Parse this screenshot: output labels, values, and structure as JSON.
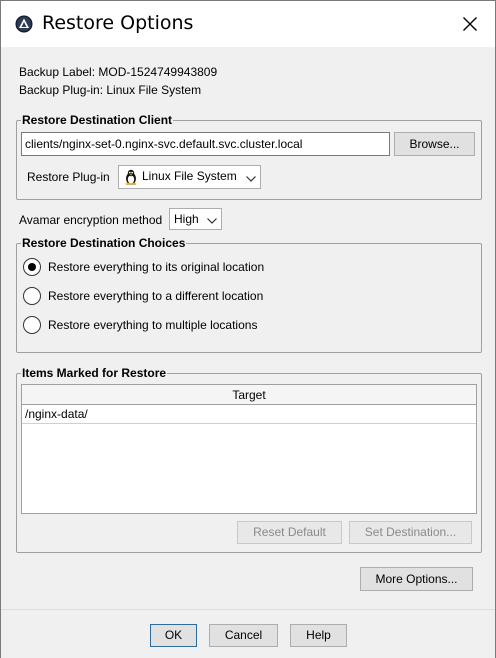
{
  "window": {
    "title": "Restore Options"
  },
  "info": {
    "backup_label": "Backup Label: MOD-1524749943809",
    "backup_plugin": "Backup Plug-in: Linux File System"
  },
  "destination_client": {
    "legend": "Restore Destination Client",
    "client_value": "clients/nginx-set-0.nginx-svc.default.svc.cluster.local",
    "browse_label": "Browse...",
    "plugin_label": "Restore Plug-in",
    "plugin_value": "Linux File System"
  },
  "encryption": {
    "label": "Avamar encryption method",
    "value": "High"
  },
  "destination_choices": {
    "legend": "Restore Destination Choices",
    "options": [
      {
        "label": "Restore everything to its original location",
        "selected": true
      },
      {
        "label": "Restore everything to a different location",
        "selected": false
      },
      {
        "label": "Restore everything to multiple locations",
        "selected": false
      }
    ]
  },
  "items": {
    "legend": "Items Marked for Restore",
    "columns": [
      "Target"
    ],
    "rows": [
      {
        "target": "/nginx-data/"
      }
    ],
    "reset_default_label": "Reset Default",
    "set_destination_label": "Set Destination..."
  },
  "more_options_label": "More Options...",
  "footer": {
    "ok_label": "OK",
    "cancel_label": "Cancel",
    "help_label": "Help"
  }
}
